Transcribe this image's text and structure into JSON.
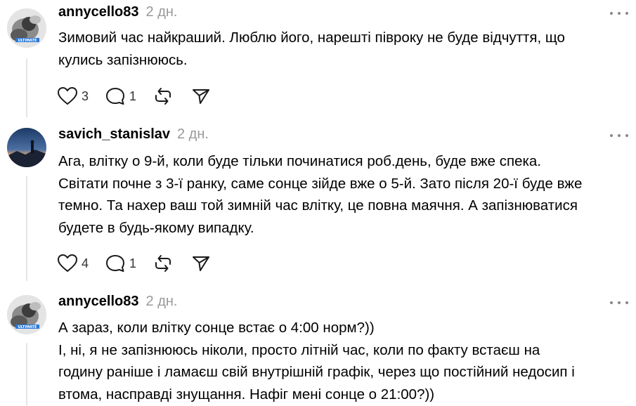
{
  "posts": [
    {
      "username": "annycello83",
      "time": "2 дн.",
      "lines": [
        "Зимовий час найкраший. Люблю його, нарешті півроку не буде відчуття, що",
        "кулись запізнююсь."
      ],
      "likes": "3",
      "replies": "1",
      "avatar_caption": "ULTIMATE"
    },
    {
      "username": "savich_stanislav",
      "time": "2 дн.",
      "lines": [
        "Ага, влітку о 9-й, коли буде тільки починатися роб.день, буде вже спека.",
        "Світати почне з 3-ї ранку, саме сонце зійде вже о 5-й. Зато після 20-ї буде вже",
        "темно. Та нахер ваш той зимній час влітку, це повна маячня. А запізнюватися",
        "будете в будь-якому випадку."
      ],
      "likes": "4",
      "replies": "1"
    },
    {
      "username": "annycello83",
      "time": "2 дн.",
      "lines": [
        "А зараз, коли влітку сонце встає о 4:00 норм?))",
        "І, ні, я не запізнююсь ніколи, просто літній час, коли по факту встаєш на",
        "годину раніше і ламаєш свій внутрішній графік, через що постійний недосип і",
        "втома, насправді знущання. Нафіг мені сонце о 21:00?))"
      ],
      "avatar_caption": "ULTIMATE"
    }
  ],
  "icons": {
    "like": "heart-icon",
    "reply": "comment-icon",
    "repost": "repost-icon",
    "share": "send-icon",
    "more": "more-icon"
  },
  "colors": {
    "text": "#000000",
    "muted": "#999999",
    "icon": "#1a1a1a",
    "thread_line": "#e5e5e5"
  }
}
